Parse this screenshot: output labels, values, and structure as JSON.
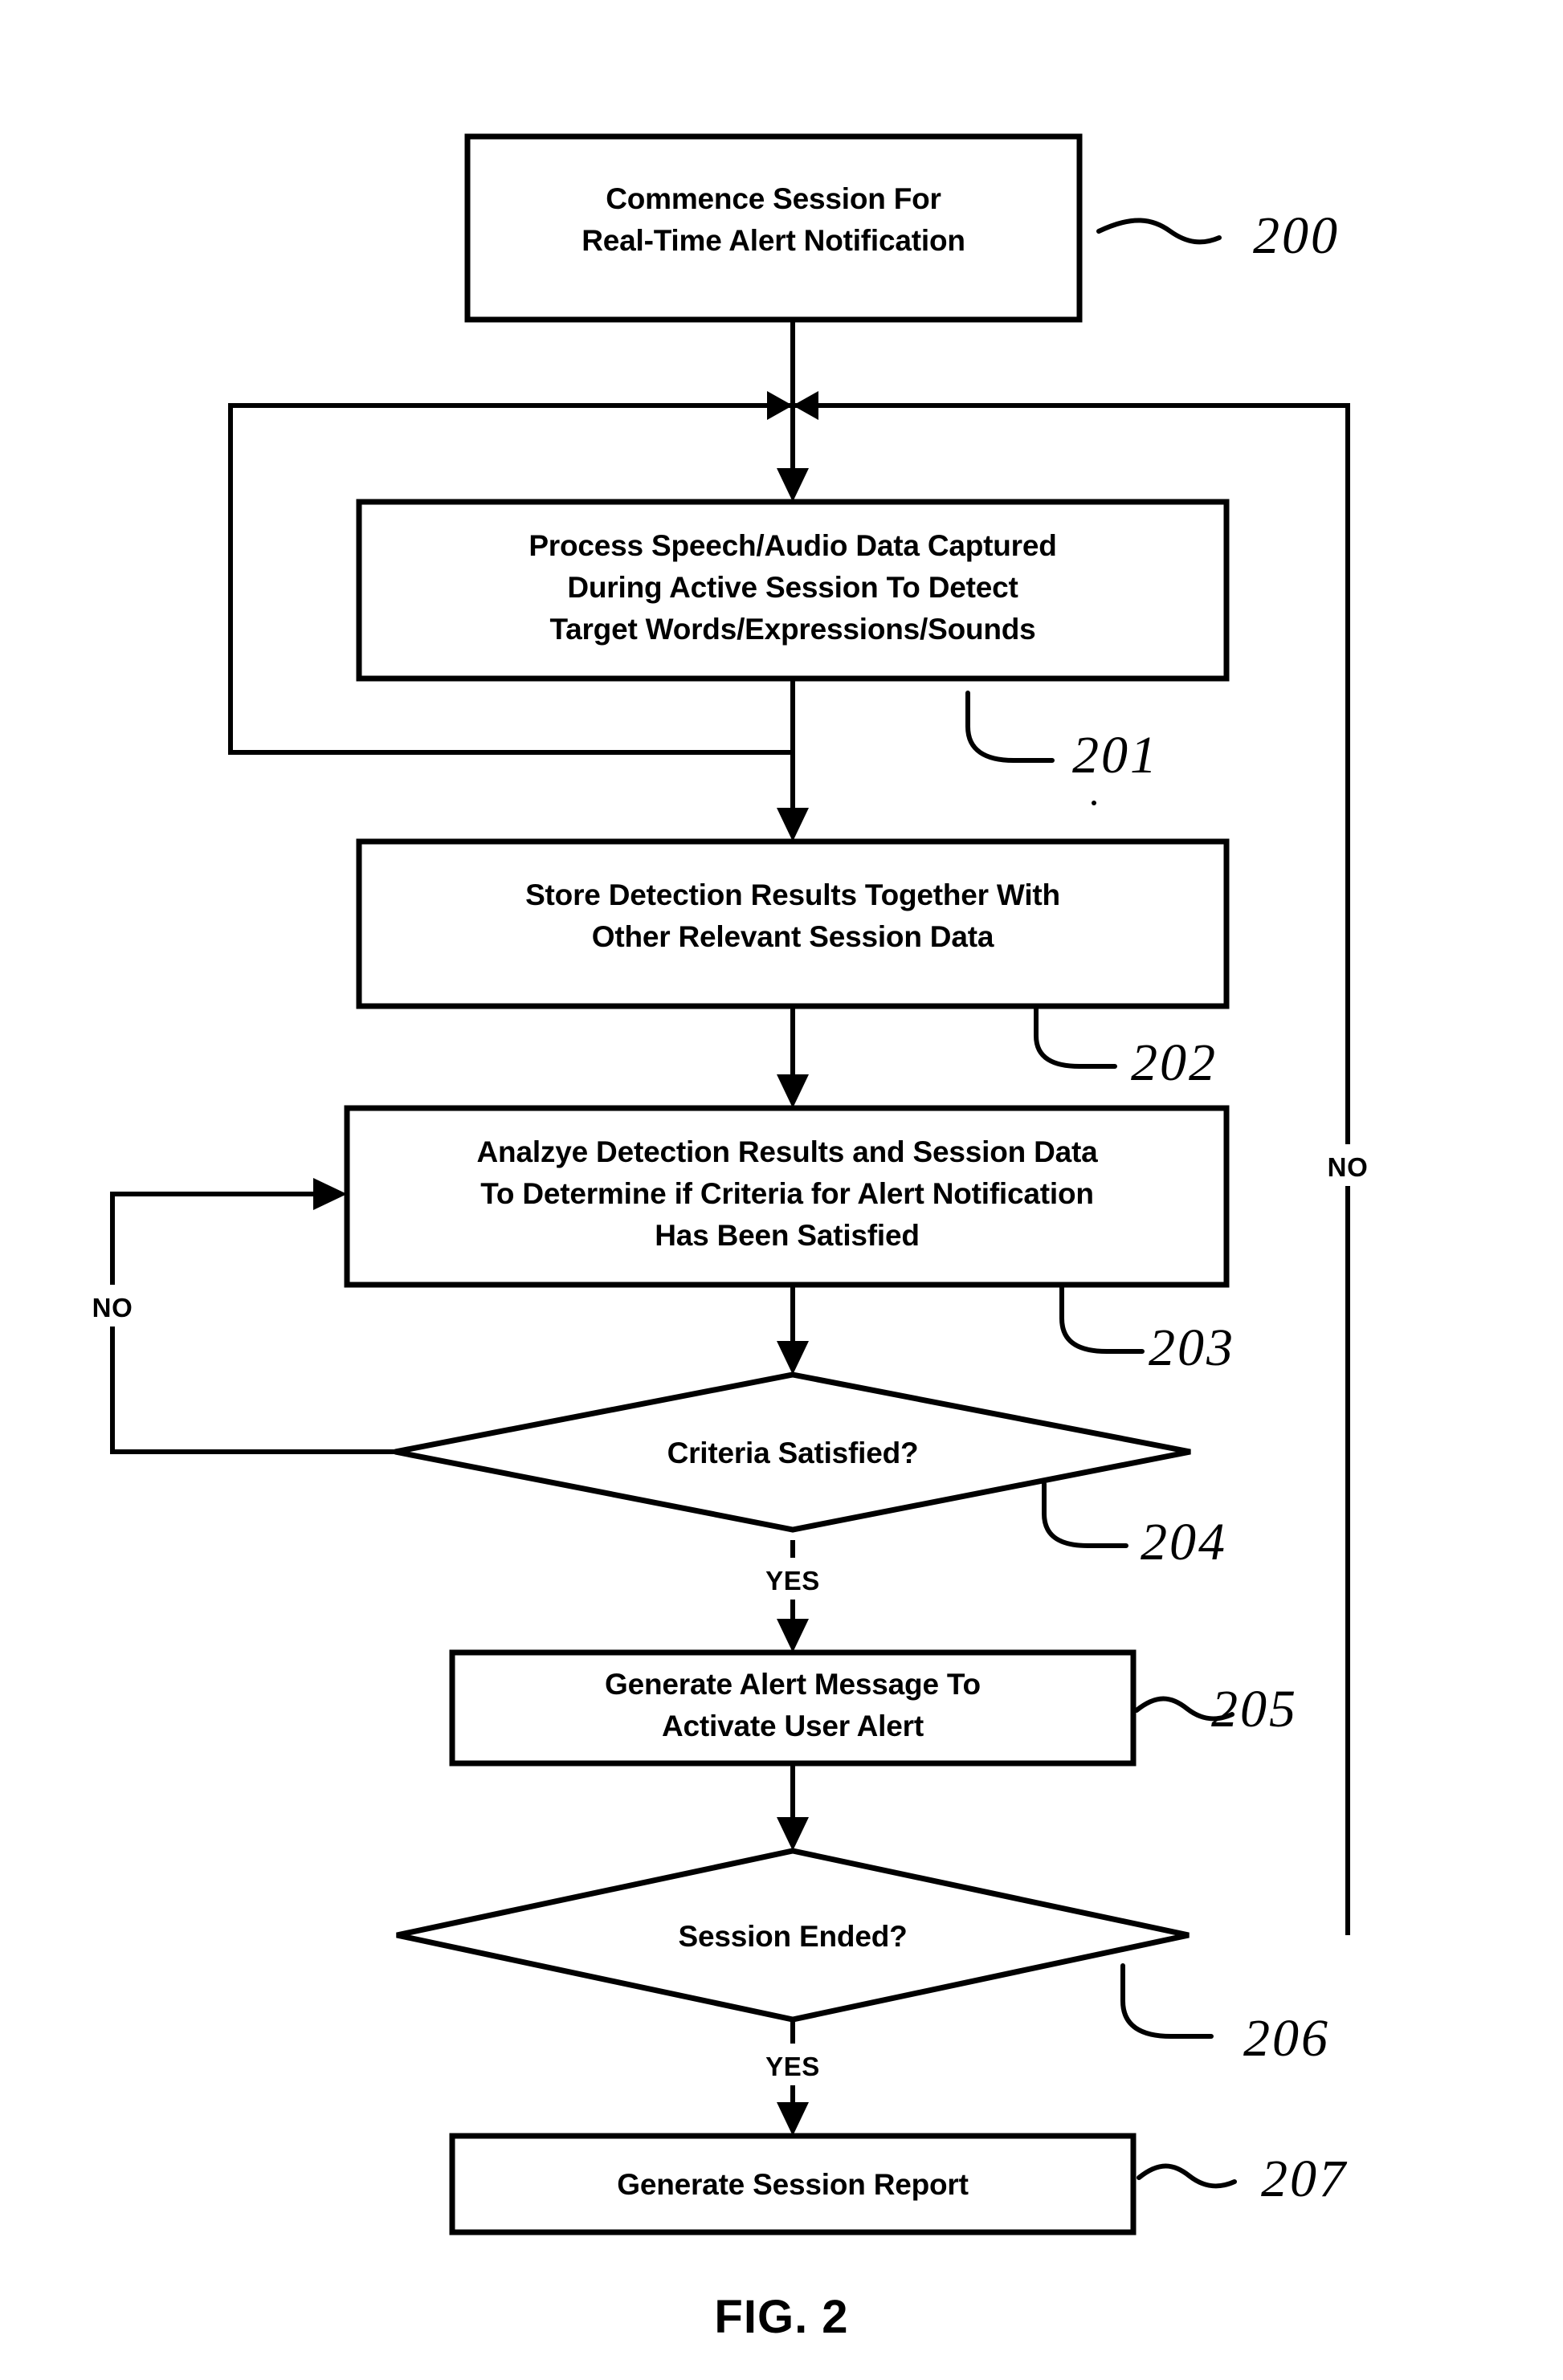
{
  "figure": {
    "caption": "FIG. 2",
    "title_implied": "Real-Time Alert Notification Process Flow"
  },
  "chart_data": {
    "type": "diagram",
    "subtype": "flowchart",
    "title": "FIG. 2",
    "nodes": [
      {
        "id": "200",
        "shape": "process",
        "ref": "200",
        "lines": [
          "Commence Session For",
          "Real-Time Alert Notification"
        ]
      },
      {
        "id": "201",
        "shape": "process",
        "ref": "201",
        "lines": [
          "Process Speech/Audio Data Captured",
          "During Active Session To Detect",
          "Target Words/Expressions/Sounds"
        ]
      },
      {
        "id": "202",
        "shape": "process",
        "ref": "202",
        "lines": [
          "Store Detection Results Together With",
          "Other Relevant Session Data"
        ]
      },
      {
        "id": "203",
        "shape": "process",
        "ref": "203",
        "lines": [
          "Analzye Detection Results and Session Data",
          "To Determine if Criteria for Alert Notification",
          "Has Been Satisfied"
        ]
      },
      {
        "id": "204",
        "shape": "decision",
        "ref": "204",
        "lines": [
          "Criteria Satisfied?"
        ]
      },
      {
        "id": "205",
        "shape": "process",
        "ref": "205",
        "lines": [
          "Generate Alert Message To",
          "Activate User Alert"
        ]
      },
      {
        "id": "206",
        "shape": "decision",
        "ref": "206",
        "lines": [
          "Session Ended?"
        ]
      },
      {
        "id": "207",
        "shape": "process",
        "ref": "207",
        "lines": [
          "Generate Session Report"
        ]
      }
    ],
    "edges": [
      {
        "from": "200",
        "to": "201",
        "label": ""
      },
      {
        "from": "201",
        "to": "202",
        "label": ""
      },
      {
        "from": "202",
        "to": "203",
        "label": ""
      },
      {
        "from": "203",
        "to": "204",
        "label": ""
      },
      {
        "from": "204",
        "to": "203",
        "label": "NO"
      },
      {
        "from": "204",
        "to": "205",
        "label": "YES"
      },
      {
        "from": "205",
        "to": "206",
        "label": ""
      },
      {
        "from": "206",
        "to": "201",
        "label": "NO"
      },
      {
        "from": "206",
        "to": "207",
        "label": "YES"
      }
    ],
    "branch_labels": {
      "no_left": "NO",
      "no_right": "NO",
      "yes_criteria": "YES",
      "yes_session": "YES"
    },
    "colors": {
      "stroke": "#000000",
      "fill": "#ffffff",
      "text": "#000000"
    }
  },
  "nodes_text": {
    "n200": {
      "l1": "Commence Session For",
      "l2": "Real-Time Alert Notification",
      "ref": "200"
    },
    "n201": {
      "l1": "Process Speech/Audio Data Captured",
      "l2": "During Active Session To Detect",
      "l3": "Target Words/Expressions/Sounds",
      "ref": "201"
    },
    "n202": {
      "l1": "Store Detection Results Together With",
      "l2": "Other Relevant Session Data",
      "ref": "202"
    },
    "n203": {
      "l1": "Analzye Detection Results and Session Data",
      "l2": "To Determine if Criteria for Alert Notification",
      "l3": "Has Been Satisfied",
      "ref": "203"
    },
    "n204": {
      "l1": "Criteria Satisfied?",
      "ref": "204"
    },
    "n205": {
      "l1": "Generate Alert Message To",
      "l2": "Activate User Alert",
      "ref": "205"
    },
    "n206": {
      "l1": "Session Ended?",
      "ref": "206"
    },
    "n207": {
      "l1": "Generate Session Report",
      "ref": "207"
    }
  },
  "labels": {
    "no_left": "NO",
    "no_right": "NO",
    "yes_after_criteria": "YES",
    "yes_after_session": "YES",
    "fig_caption": "FIG. 2"
  }
}
